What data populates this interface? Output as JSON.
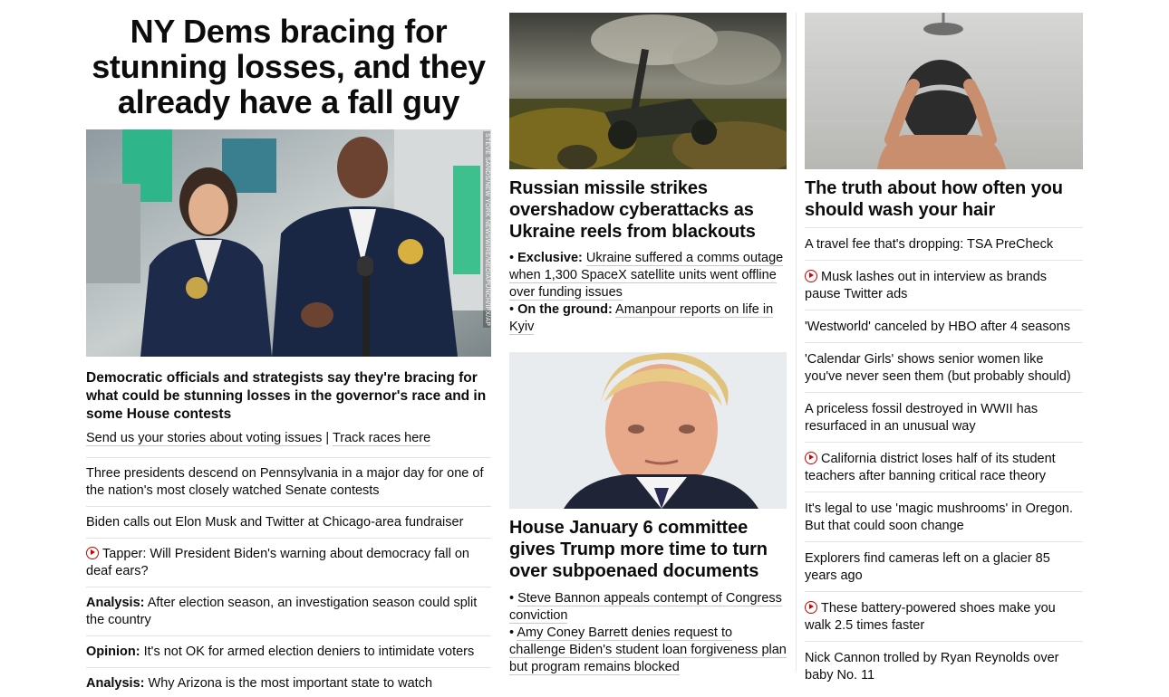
{
  "lead": {
    "headline": "NY Dems bracing for stunning losses, and they already have a fall guy",
    "image_credit": "STEVE SANDS/NEW YORK NEWSWIRE/MEDIAPUNCH/IPX/AP",
    "summary": "Democratic officials and strategists say they're bracing for what could be stunning losses in the governor's race and in some House contests",
    "link1": "Send us your stories about voting issues",
    "separator": "|",
    "link2": "Track races here"
  },
  "col1_list": [
    {
      "label": "",
      "text": "Three presidents descend on Pennsylvania in a major day for one of the nation's most closely watched Senate contests",
      "video": false
    },
    {
      "label": "",
      "text": "Biden calls out Elon Musk and Twitter at Chicago-area fundraiser",
      "video": false
    },
    {
      "label": "",
      "text": "Tapper: Will President Biden's warning about democracy fall on deaf ears?",
      "video": true
    },
    {
      "label": "Analysis:",
      "text": "After election season, an investigation season could split the country",
      "video": false
    },
    {
      "label": "Opinion:",
      "text": "It's not OK for armed election deniers to intimidate voters",
      "video": false
    },
    {
      "label": "Analysis:",
      "text": "Why Arizona is the most important state to watch",
      "video": false
    }
  ],
  "ukraine": {
    "headline": "Russian missile strikes overshadow cyberattacks as Ukraine reels from blackouts",
    "bullet1_label": "Exclusive:",
    "bullet1_text": "Ukraine suffered a comms outage when 1,300 SpaceX satellite units went offline over funding issues",
    "bullet2_label": "On the ground:",
    "bullet2_text": "Amanpour reports on life in Kyiv"
  },
  "trump": {
    "headline": "House January 6 committee gives Trump more time to turn over subpoenaed documents",
    "bullet1_text": "Steve Bannon appeals contempt of Congress conviction",
    "bullet2_text": "Amy Coney Barrett denies request to challenge Biden's student loan forgiveness plan but program remains blocked"
  },
  "hair": {
    "headline": "The truth about how often you should wash your hair"
  },
  "col3_list": [
    {
      "text": "A travel fee that's dropping: TSA PreCheck",
      "video": false
    },
    {
      "text": "Musk lashes out in interview as brands pause Twitter ads",
      "video": true
    },
    {
      "text": "'Westworld' canceled by HBO after 4 seasons",
      "video": false
    },
    {
      "text": "'Calendar Girls' shows senior women like you've never seen them (but probably should)",
      "video": false
    },
    {
      "text": "A priceless fossil destroyed in WWII has resurfaced in an unusual way",
      "video": false
    },
    {
      "text": "California district loses half of its student teachers after banning critical race theory",
      "video": true
    },
    {
      "text": "It's legal to use 'magic mushrooms' in Oregon. But that could soon change",
      "video": false
    },
    {
      "text": "Explorers find cameras left on a glacier 85 years ago",
      "video": false
    },
    {
      "text": "These battery-powered shoes make you walk 2.5 times faster",
      "video": true
    },
    {
      "text": "Nick Cannon trolled by Ryan Reynolds over baby No. 11",
      "video": false
    }
  ],
  "colors": {
    "video_red": "#cc0000",
    "text": "#0c0c0c",
    "divider": "#e3e3e3"
  }
}
